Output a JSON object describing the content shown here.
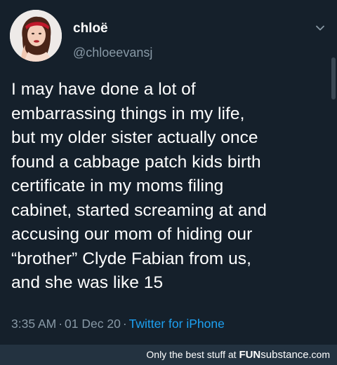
{
  "author": {
    "display_name": "chloë",
    "handle": "@chloeevansj"
  },
  "tweet": {
    "text": "I may have done a lot of\nembarrassing things in my life,\nbut my older sister actually once\nfound a cabbage patch kids birth\ncertificate in my moms filing\ncabinet, started screaming at and\naccusing our mom of hiding our\n“brother” Clyde Fabian from us,\nand she was like 15",
    "time": "3:35 AM",
    "separator": "·",
    "date": "01 Dec 20",
    "source": "Twitter for iPhone"
  },
  "footer": {
    "tagline": "Only the best stuff at ",
    "brand_fun": "FUN",
    "brand_substance": "substance",
    "brand_tld": ".com"
  },
  "colors": {
    "background": "#15202b",
    "secondary_text": "#8899a6",
    "link": "#1da1f2",
    "footer_bg": "#233240"
  },
  "icons": {
    "menu": "chevron-down-icon",
    "avatar": "profile-photo"
  }
}
